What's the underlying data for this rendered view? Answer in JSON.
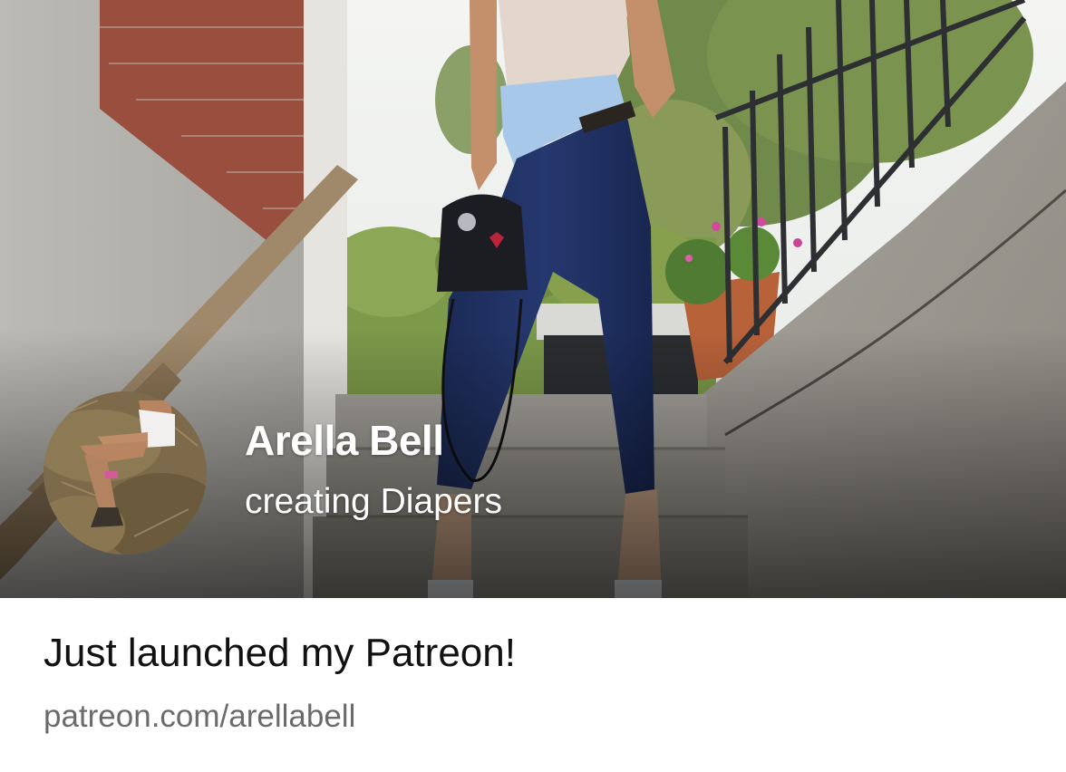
{
  "card": {
    "cover_image": "cover-photo",
    "profile_image": "profile-photo",
    "creator_name": "Arella Bell",
    "creator_tagline": "creating Diapers",
    "headline": "Just launched my Patreon!",
    "link_url": "patreon.com/arellabell"
  },
  "colors": {
    "name_text": "#ffffff",
    "headline_text": "#111111",
    "url_text": "#6b6b6b",
    "card_background": "#ffffff"
  }
}
